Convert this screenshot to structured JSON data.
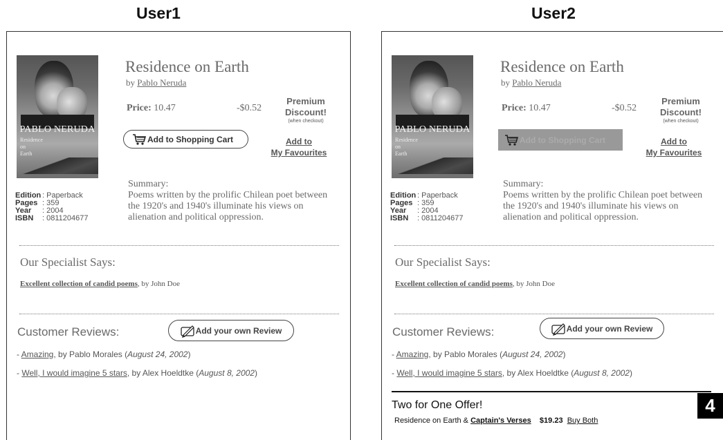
{
  "labels": {
    "user1": "User1",
    "user2": "User2",
    "badge": "4"
  },
  "book": {
    "cover_author": "PABLO NERUDA",
    "cover_title_lines": [
      "Residence",
      "on",
      "Earth"
    ],
    "title": "Residence on Earth",
    "by_prefix": "by ",
    "author": "Pablo Neruda",
    "price_label": "Price:",
    "price_value": "10.47",
    "discount": "-$0.52",
    "premium_line1": "Premium",
    "premium_line2": "Discount!",
    "premium_note": "(when checkout)",
    "add_to_cart": "Add to Shopping Cart",
    "fav_line1": "Add to",
    "fav_line2": "My Favourites",
    "summary_label": "Summary:",
    "summary_text": "Poems written by the prolific Chilean poet between the 1920's and 1940's illuminate his views on alienation and political oppression.",
    "details": [
      {
        "key": "Edition",
        "value": ": Paperback"
      },
      {
        "key": "Pages",
        "value": ": 359"
      },
      {
        "key": "Year",
        "value": ": 2004"
      },
      {
        "key": "ISBN",
        "value": ": 0811204677"
      }
    ]
  },
  "specialist": {
    "heading": "Our Specialist Says:",
    "review_title": "Excellent collection of candid poems",
    "review_by": ", by John Doe"
  },
  "customer_reviews": {
    "heading": "Customer Reviews:",
    "add_review": "Add your own Review",
    "items": [
      {
        "dash": "- ",
        "title": "Amazing",
        "by": ", by Pablo Morales (",
        "date": "August 24, 2002",
        "close": ")"
      },
      {
        "dash": "- ",
        "title": "Well, I would imagine 5 stars",
        "by": ", by Alex Hoeldtke (",
        "date": "August 8, 2002",
        "close": ")"
      }
    ]
  },
  "offer": {
    "title": "Two for One Offer!",
    "book1": "Residence on Earth & ",
    "book2": "Captain's Verses",
    "price": "$19.23",
    "buy": "Buy Both"
  }
}
